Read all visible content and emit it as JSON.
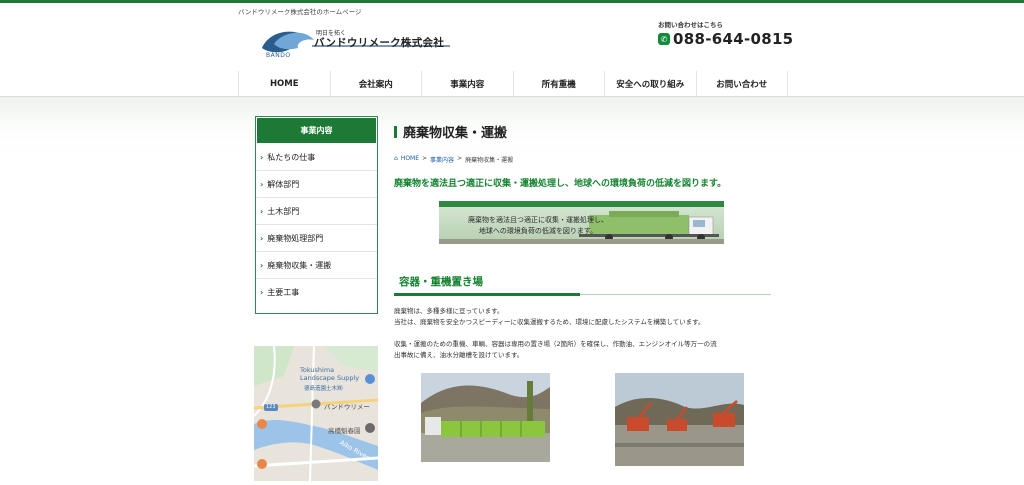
{
  "header": {
    "tagline": "バンドウリメーク株式会社のホームページ",
    "logo_slogan": "明日を拓く",
    "logo_name": "バンドウリメーク株式会社",
    "logo_brand": "BANDO",
    "contact_label": "お問い合わせはこちら",
    "phone": "088-644-0815"
  },
  "nav": {
    "items": [
      {
        "label": "HOME"
      },
      {
        "label": "会社案内"
      },
      {
        "label": "事業内容"
      },
      {
        "label": "所有重機"
      },
      {
        "label": "安全への取り組み"
      },
      {
        "label": "お問い合わせ"
      }
    ]
  },
  "sidebar": {
    "heading": "事業内容",
    "items": [
      {
        "label": "私たちの仕事"
      },
      {
        "label": "解体部門"
      },
      {
        "label": "土木部門"
      },
      {
        "label": "廃棄物処理部門"
      },
      {
        "label": "廃棄物収集・運搬"
      },
      {
        "label": "主要工事"
      }
    ]
  },
  "map": {
    "label_landscape": "Tokushima Landscape Supply",
    "label_landscape_jp": "德島造園土木㈱",
    "label_company": "バンドウリメー",
    "label_park": "高橋魁春園",
    "label_river": "Aiko River",
    "label_route": "123"
  },
  "main": {
    "title": "廃棄物収集・運搬",
    "breadcrumb": {
      "home": "HOME",
      "section": "事業内容",
      "current": "廃棄物収集・運搬"
    },
    "lead": "廃棄物を適法且つ適正に収集・運搬処理し、地球への環境負荷の低減を図ります。",
    "banner_line1": "廃棄物を適法且つ適正に収集・運搬処理し、",
    "banner_line2": "地球への環境負荷の低減を図ります。",
    "section_title": "容器・重機置き場",
    "p1_line1": "廃棄物は、多種多様に亘っています。",
    "p1_line2": "当社は、廃棄物を安全かつスピーディーに収集運搬するため、環境に配慮したシステムを構築しています。",
    "p2_line1": "収集・運搬のための重機、車輌、容器は専用の置き場（2箇所）を確保し、作動油、エンジンオイル等万一の流",
    "p2_line2": "出事故に備え、油水分離槽を設けています。"
  },
  "colors": {
    "brand_green": "#1d7a36",
    "text_green": "#14832f",
    "link_blue": "#1a5aa8"
  }
}
